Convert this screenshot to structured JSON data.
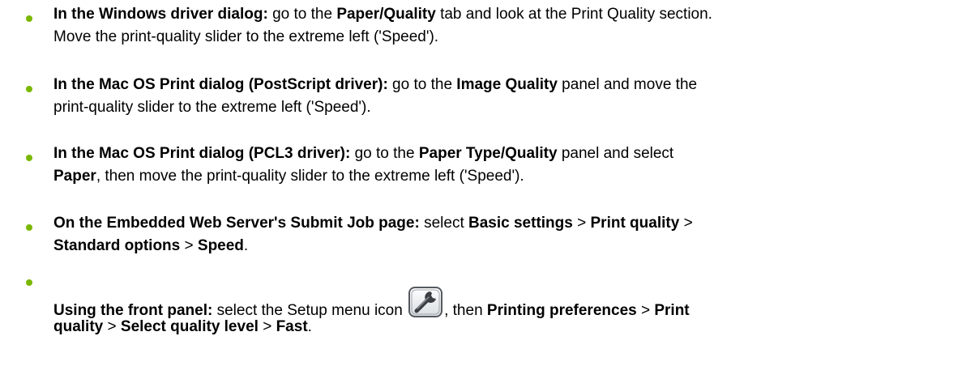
{
  "accent_color": "#7ab800",
  "items": [
    {
      "lead": "In the Windows driver dialog:",
      "t1": " go to the ",
      "b1": "Paper/Quality",
      "t2": " tab and look at the Print Quality section.",
      "line2": "Move the print-quality slider to the extreme left ('Speed')."
    },
    {
      "lead": "In the Mac OS Print dialog (PostScript driver):",
      "t1": " go to the ",
      "b1": "Image Quality",
      "t2": " panel and move the",
      "line2": "print-quality slider to the extreme left ('Speed')."
    },
    {
      "lead": "In the Mac OS Print dialog (PCL3 driver):",
      "t1": " go to the ",
      "b1": "Paper Type/Quality",
      "t2": " panel and select",
      "b2": "Paper",
      "t3": ", then move the print-quality slider to the extreme left ('Speed')."
    },
    {
      "lead": "On the Embedded Web Server's Submit Job page:",
      "t1": " select ",
      "b1": "Basic settings",
      "sep1": " > ",
      "b2": "Print quality",
      "sep2": " >",
      "b3": "Standard options",
      "sep3": " > ",
      "b4": "Speed",
      "end": "."
    },
    {
      "lead": "Using the front panel:",
      "t1": " select the Setup menu icon ",
      "icon": "wrench-setup-icon",
      "t2": ", then ",
      "b1": "Printing preferences",
      "sep1": " > ",
      "b2": "Print",
      "b3": "quality",
      "sep2": " > ",
      "b4": "Select quality level",
      "sep3": " > ",
      "b5": "Fast",
      "end": "."
    }
  ]
}
